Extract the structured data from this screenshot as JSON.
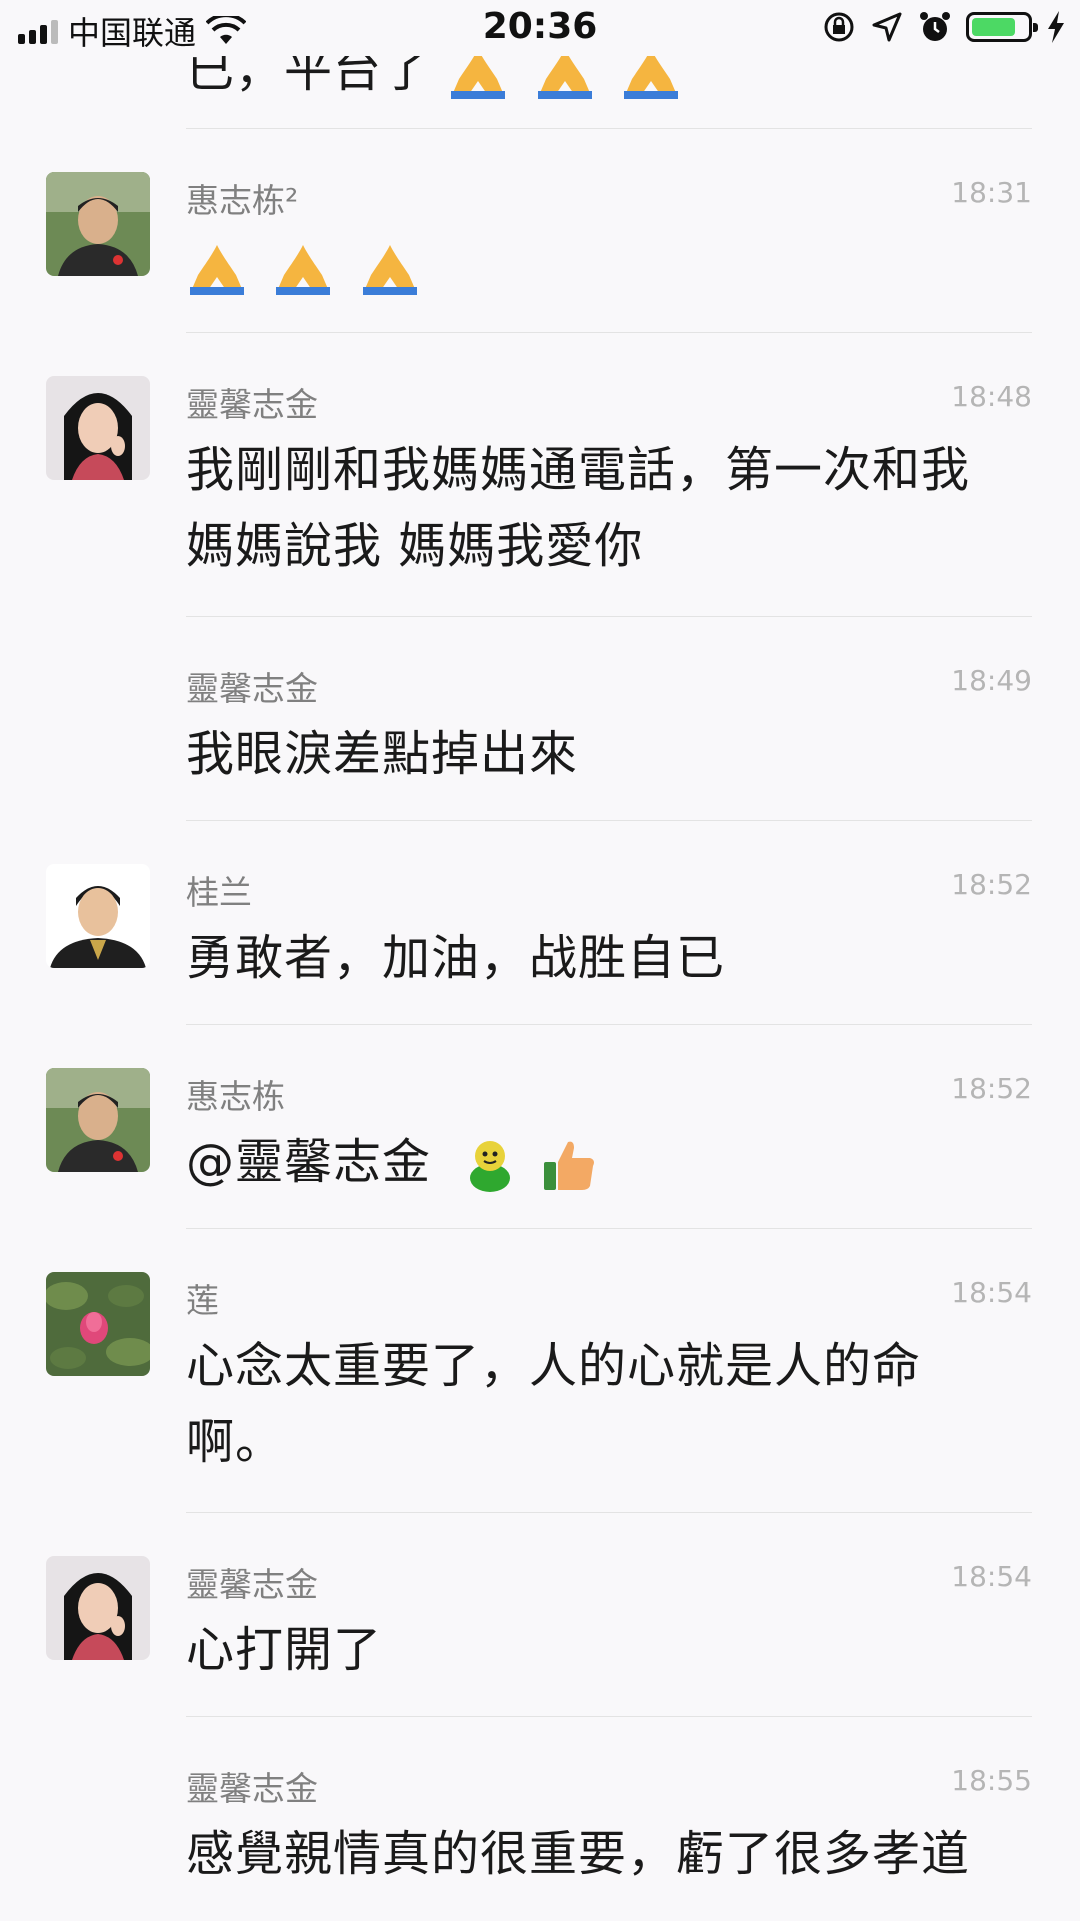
{
  "status_bar": {
    "carrier": "中国联通",
    "time": "20:36"
  },
  "top_partial": {
    "text": "已，平台了",
    "emoji": [
      "praying-hands",
      "praying-hands",
      "praying-hands"
    ]
  },
  "messages": [
    {
      "name": "惠志栋²",
      "time": "18:31",
      "text": "",
      "emoji": [
        "praying-hands",
        "praying-hands",
        "praying-hands"
      ],
      "avatar": "avatar-man"
    },
    {
      "name": "靈馨志金",
      "time": "18:48",
      "text": "我剛剛和我媽媽通電話，第一次和我媽媽說我 媽媽我愛你",
      "avatar": "avatar-woman"
    },
    {
      "name": "靈馨志金",
      "time": "18:49",
      "text": "我眼淚差點掉出來",
      "avatar": ""
    },
    {
      "name": "桂兰",
      "time": "18:52",
      "text": "勇敢者，加油，战胜自已",
      "avatar": "avatar-guilan"
    },
    {
      "name": "惠志栋",
      "time": "18:52",
      "text": "@靈馨志金",
      "emoji": [
        "green-figure",
        "thumbs-up"
      ],
      "avatar": "avatar-man"
    },
    {
      "name": "莲",
      "time": "18:54",
      "text": "心念太重要了，人的心就是人的命啊。",
      "avatar": "avatar-lotus"
    },
    {
      "name": "靈馨志金",
      "time": "18:54",
      "text": "心打開了",
      "avatar": "avatar-woman"
    },
    {
      "name": "靈馨志金",
      "time": "18:55",
      "text": "感覺親情真的很重要，虧了很多孝道",
      "avatar": ""
    }
  ]
}
